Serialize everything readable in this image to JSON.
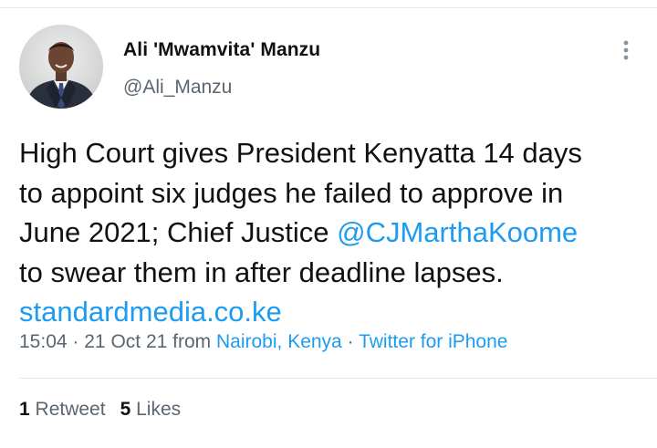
{
  "author": {
    "display_name": "Ali 'Mwamvita' Manzu",
    "handle": "@Ali_Manzu"
  },
  "tweet": {
    "line1": "High Court gives President Kenyatta 14 days",
    "line2": "to appoint six judges he failed to approve in",
    "line3_prefix": "June 2021; Chief Justice ",
    "mention": "@CJMarthaKoome",
    "line4": "to swear them in after deadline lapses.",
    "url": "standardmedia.co.ke"
  },
  "meta": {
    "time": "15:04",
    "date": "21 Oct 21",
    "from_label": "from",
    "location": "Nairobi, Kenya",
    "client": "Twitter for iPhone",
    "separator": "·"
  },
  "stats": {
    "retweets_count": "1",
    "retweets_label": "Retweet",
    "likes_count": "5",
    "likes_label": "Likes"
  },
  "icons": {
    "more": "more-vertical-icon",
    "avatar": "profile-photo"
  },
  "colors": {
    "link": "#1d9bf0",
    "secondary_text": "#5b6670",
    "primary_text": "#111111",
    "divider": "#e6e9ec"
  }
}
